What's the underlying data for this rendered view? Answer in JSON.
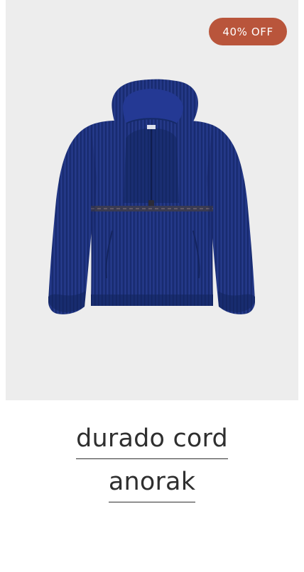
{
  "badge": {
    "text": "40% OFF",
    "color": "#b9553b"
  },
  "product": {
    "title_lines": [
      "durado cord",
      "anorak"
    ],
    "image_color": "#1e3181"
  }
}
